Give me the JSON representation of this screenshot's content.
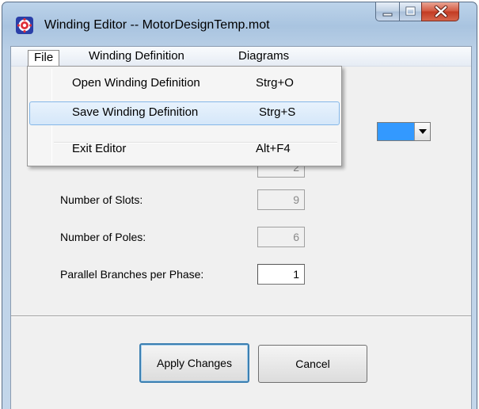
{
  "window": {
    "title": "Winding Editor -- MotorDesignTemp.mot"
  },
  "menubar": {
    "items": [
      {
        "label": "File"
      },
      {
        "label": "Winding Definition"
      },
      {
        "label": "Diagrams"
      }
    ]
  },
  "file_menu": {
    "items": [
      {
        "label": "Open Winding Definition",
        "shortcut": "Strg+O",
        "highlighted": false
      },
      {
        "label": "Save Winding Definition",
        "shortcut": "Strg+S",
        "highlighted": true
      },
      {
        "label": "Exit Editor",
        "shortcut": "Alt+F4",
        "highlighted": false
      }
    ]
  },
  "form": {
    "hidden_field_value": "2",
    "slots": {
      "label": "Number of Slots:",
      "value": "9"
    },
    "poles": {
      "label": "Number of Poles:",
      "value": "6"
    },
    "parallel": {
      "label": "Parallel Branches per Phase:",
      "value": "1"
    }
  },
  "buttons": {
    "apply": "Apply Changes",
    "cancel": "Cancel"
  },
  "colors": {
    "selection": "#3399ff",
    "highlight_border": "#84b7e8",
    "close_button": "#c23a22"
  }
}
